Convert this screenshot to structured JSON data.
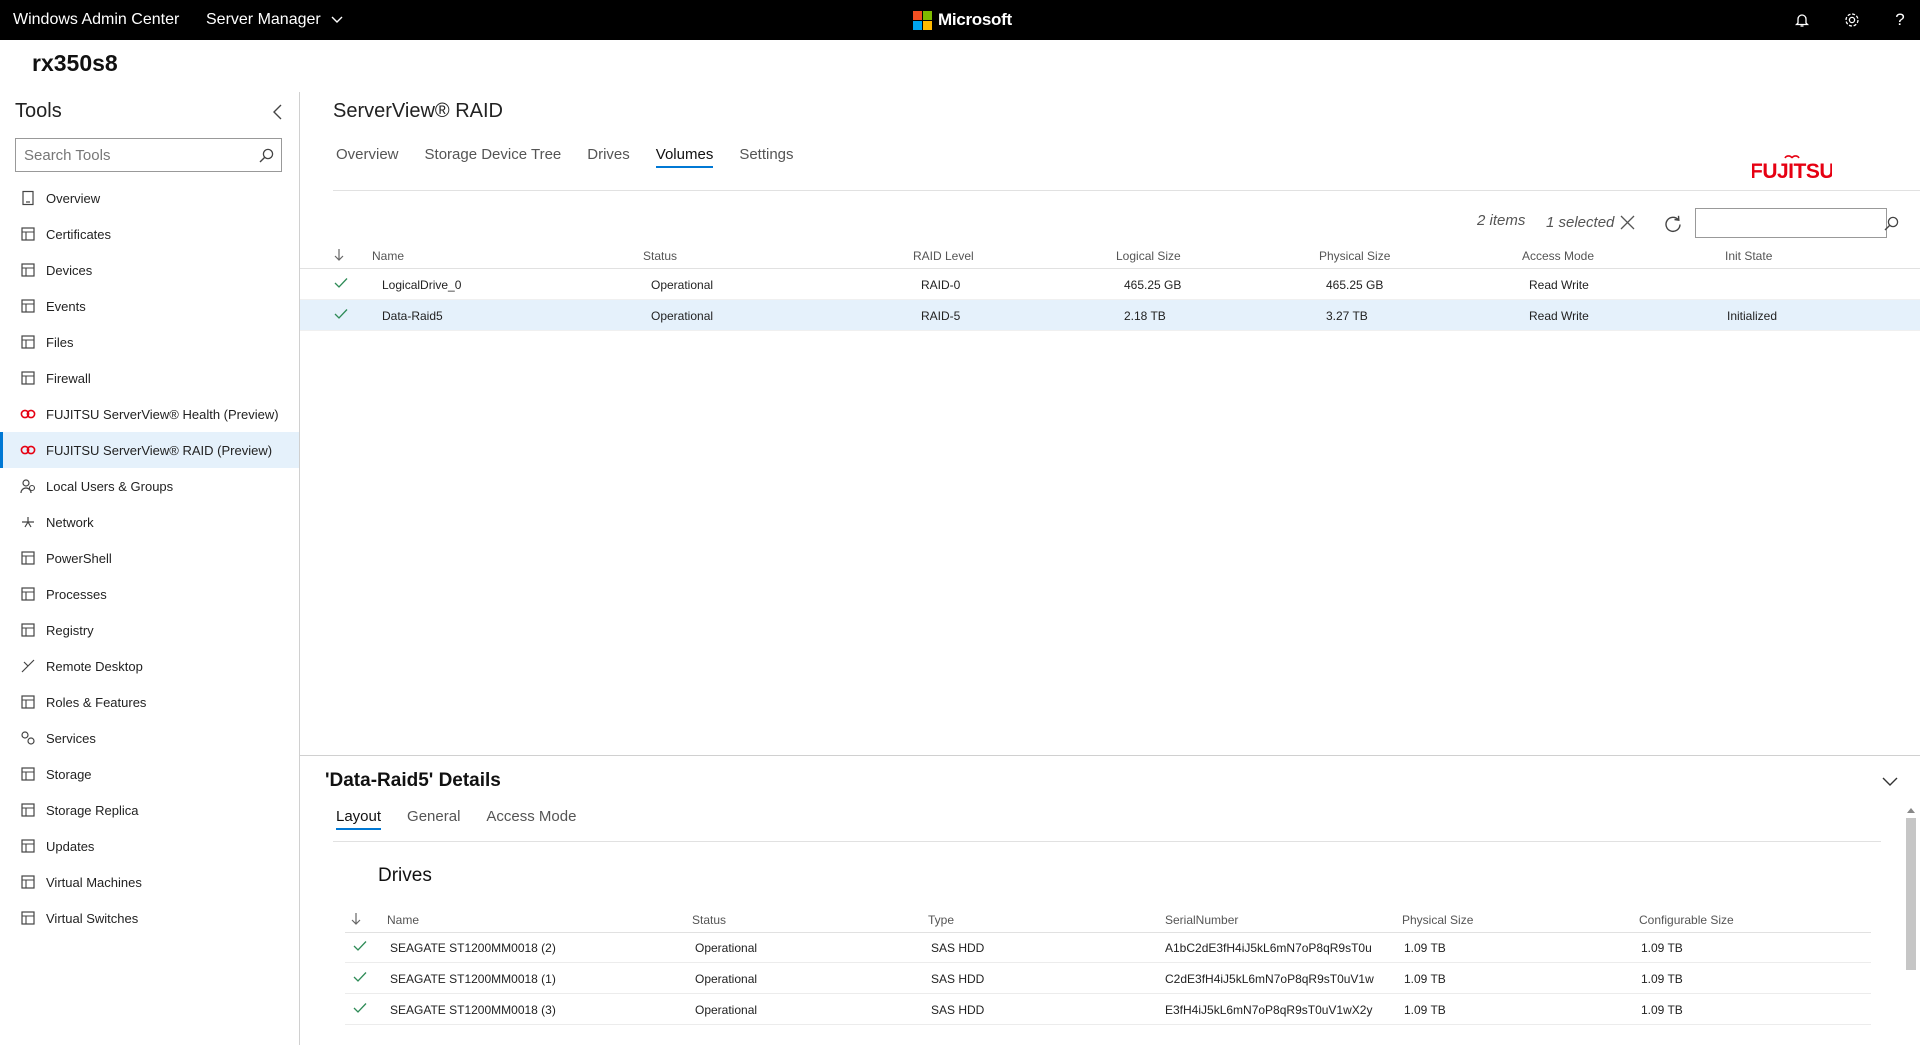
{
  "topbar": {
    "product": "Windows Admin Center",
    "manager": "Server Manager",
    "logo_text": "Microsoft",
    "logo_colors": [
      "#f25022",
      "#7fba00",
      "#00a4ef",
      "#ffb900"
    ],
    "icons": [
      "bell-icon",
      "gear-icon",
      "help-icon"
    ],
    "help_glyph": "?"
  },
  "server": {
    "name": "rx350s8"
  },
  "sidebar": {
    "title": "Tools",
    "search_placeholder": "Search Tools",
    "items": [
      {
        "label": "Overview",
        "icon": "overview-icon"
      },
      {
        "label": "Certificates",
        "icon": "certificate-icon"
      },
      {
        "label": "Devices",
        "icon": "devices-icon"
      },
      {
        "label": "Events",
        "icon": "events-icon"
      },
      {
        "label": "Files",
        "icon": "files-icon"
      },
      {
        "label": "Firewall",
        "icon": "firewall-icon"
      },
      {
        "label": "FUJITSU ServerView® Health (Preview)",
        "icon": "fujitsu-icon"
      },
      {
        "label": "FUJITSU ServerView® RAID (Preview)",
        "icon": "fujitsu-icon",
        "active": true
      },
      {
        "label": "Local Users & Groups",
        "icon": "users-icon"
      },
      {
        "label": "Network",
        "icon": "network-icon"
      },
      {
        "label": "PowerShell",
        "icon": "powershell-icon"
      },
      {
        "label": "Processes",
        "icon": "processes-icon"
      },
      {
        "label": "Registry",
        "icon": "registry-icon"
      },
      {
        "label": "Remote Desktop",
        "icon": "remote-desktop-icon"
      },
      {
        "label": "Roles & Features",
        "icon": "roles-icon"
      },
      {
        "label": "Services",
        "icon": "services-icon"
      },
      {
        "label": "Storage",
        "icon": "storage-icon"
      },
      {
        "label": "Storage Replica",
        "icon": "storage-replica-icon"
      },
      {
        "label": "Updates",
        "icon": "updates-icon"
      },
      {
        "label": "Virtual Machines",
        "icon": "virtual-machines-icon"
      },
      {
        "label": "Virtual Switches",
        "icon": "virtual-switches-icon"
      }
    ]
  },
  "main": {
    "title": "ServerView® RAID",
    "tabs": [
      {
        "label": "Overview"
      },
      {
        "label": "Storage Device Tree"
      },
      {
        "label": "Drives"
      },
      {
        "label": "Volumes",
        "active": true
      },
      {
        "label": "Settings"
      }
    ],
    "brand_logo": "FUJITSU",
    "brand_color": "#e60012",
    "accent_color": "#0078d4",
    "items_count": "2 items",
    "selected_count": "1 selected",
    "columns": [
      "Name",
      "Status",
      "RAID Level",
      "Logical Size",
      "Physical Size",
      "Access Mode",
      "Init State"
    ],
    "rows": [
      {
        "status_icon": "check-icon",
        "name": "LogicalDrive_0",
        "status": "Operational",
        "raid": "RAID-0",
        "logical": "465.25 GB",
        "physical": "465.25 GB",
        "access": "Read Write",
        "init": ""
      },
      {
        "status_icon": "check-icon",
        "name": "Data-Raid5",
        "status": "Operational",
        "raid": "RAID-5",
        "logical": "2.18 TB",
        "physical": "3.27 TB",
        "access": "Read Write",
        "init": "Initialized",
        "selected": true
      }
    ]
  },
  "details": {
    "title": "'Data-Raid5' Details",
    "tabs": [
      {
        "label": "Layout",
        "active": true
      },
      {
        "label": "General"
      },
      {
        "label": "Access Mode"
      }
    ],
    "drives_title": "Drives",
    "columns": [
      "Name",
      "Status",
      "Type",
      "SerialNumber",
      "Physical Size",
      "Configurable Size"
    ],
    "rows": [
      {
        "name": "SEAGATE ST1200MM0018 (2)",
        "status": "Operational",
        "type": "SAS HDD",
        "serial": "A1bC2dE3fH4iJ5kL6mN7oP8qR9sT0u",
        "physical": "1.09 TB",
        "configurable": "1.09 TB"
      },
      {
        "name": "SEAGATE ST1200MM0018 (1)",
        "status": "Operational",
        "type": "SAS HDD",
        "serial": "C2dE3fH4iJ5kL6mN7oP8qR9sT0uV1w",
        "physical": "1.09 TB",
        "configurable": "1.09 TB"
      },
      {
        "name": "SEAGATE ST1200MM0018 (3)",
        "status": "Operational",
        "type": "SAS HDD",
        "serial": "E3fH4iJ5kL6mN7oP8qR9sT0uV1wX2y",
        "physical": "1.09 TB",
        "configurable": "1.09 TB"
      }
    ]
  }
}
